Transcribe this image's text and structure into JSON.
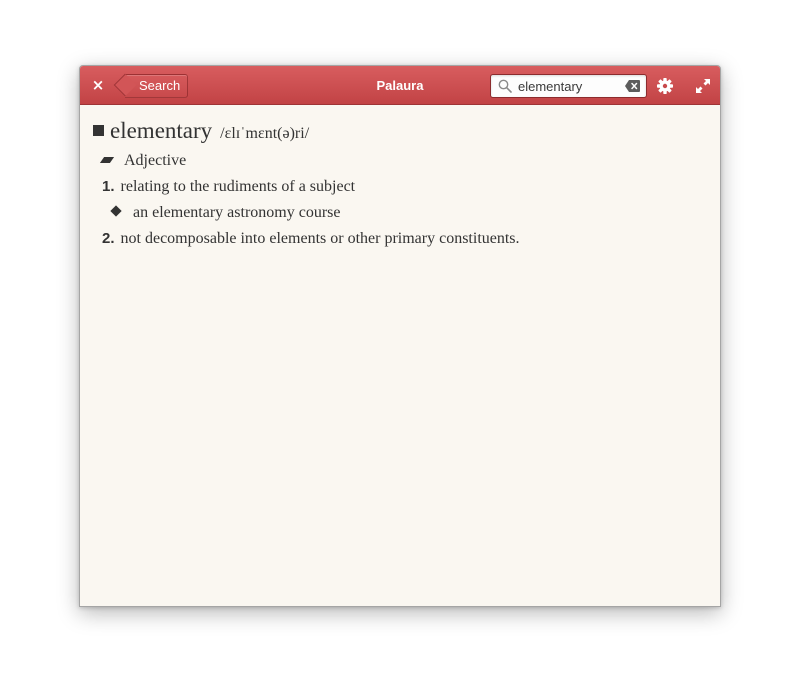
{
  "window": {
    "title": "Palaura"
  },
  "header": {
    "close_label": "×",
    "back_label": "Search",
    "search_value": "elementary",
    "accent_color": "#c8494b"
  },
  "entry": {
    "word": "elementary",
    "pronunciation": "/ɛlɪˈmɛnt(ə)ri/",
    "part_of_speech": "Adjective",
    "definitions": [
      {
        "number": "1.",
        "text": "relating to the rudiments of a subject",
        "example": "an elementary astronomy course"
      },
      {
        "number": "2.",
        "text": "not decomposable into elements or other primary constituents."
      }
    ]
  },
  "icons": {
    "close": "close-icon",
    "back": "back-arrow",
    "search": "search-icon",
    "clear": "clear-text-icon",
    "settings": "gear-icon",
    "maximize": "maximize-icon"
  }
}
